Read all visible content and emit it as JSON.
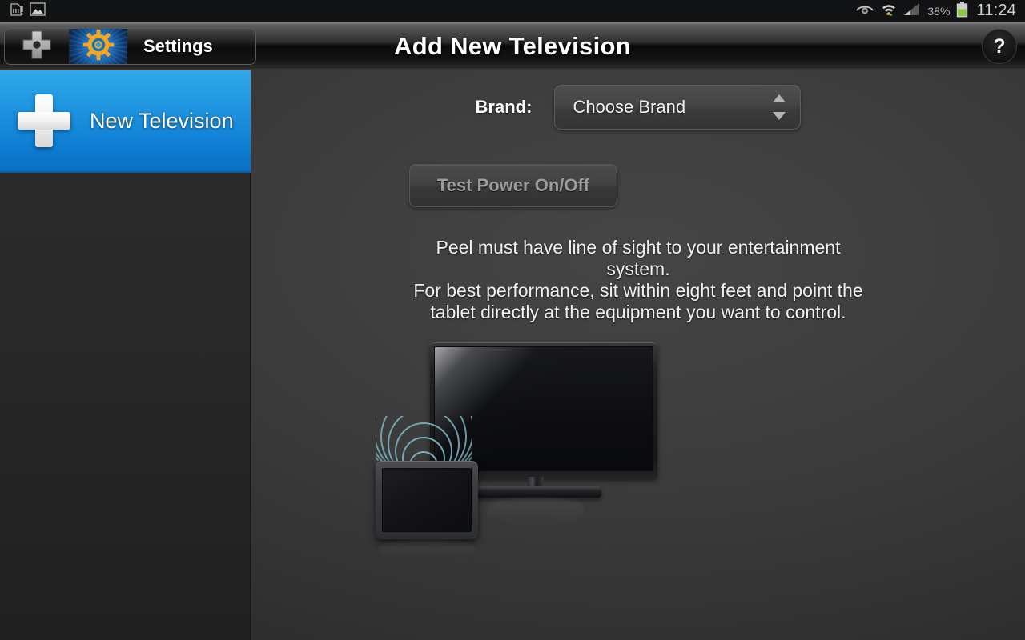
{
  "status_bar": {
    "left_icons": [
      "sd-card-alert-icon",
      "gallery-image-icon"
    ],
    "right_icons": [
      "smart-stay-eye-icon",
      "wifi-data-transfer-icon",
      "cellular-signal-icon",
      "battery-icon"
    ],
    "battery_percent": "38%",
    "clock": "11:24"
  },
  "header": {
    "dpad_icon": "dpad-icon",
    "gear_icon": "gear-icon",
    "settings_label": "Settings",
    "title": "Add New Television",
    "help_label": "?"
  },
  "sidebar": {
    "items": [
      {
        "label": "New Television",
        "icon": "plus-icon",
        "selected": true
      }
    ]
  },
  "main": {
    "brand_label": "Brand:",
    "brand_select": {
      "value": "Choose Brand",
      "placeholder": "Choose Brand",
      "spinner_icon": "spinner-up-down-icon"
    },
    "test_power_label": "Test Power On/Off",
    "instructions": [
      "Peel must have line of sight to your entertainment",
      "system.",
      "For best performance, sit within eight feet and point the",
      "tablet directly at the equipment you want to control."
    ],
    "illustration": {
      "tv": "television-illustration",
      "tablet": "tablet-illustration",
      "waves": "infrared-signal-waves"
    }
  },
  "colors": {
    "accent_blue": "#1f94e0",
    "header_dark": "#0b0b0b",
    "sidebar_bg": "#2b2b2b",
    "main_bg": "#3b3b3b",
    "wave_teal": "#7fb8c6",
    "gear_orange": "#f5a623",
    "battery_green": "#8cc63f",
    "disabled_text": "#9c9c9c"
  }
}
